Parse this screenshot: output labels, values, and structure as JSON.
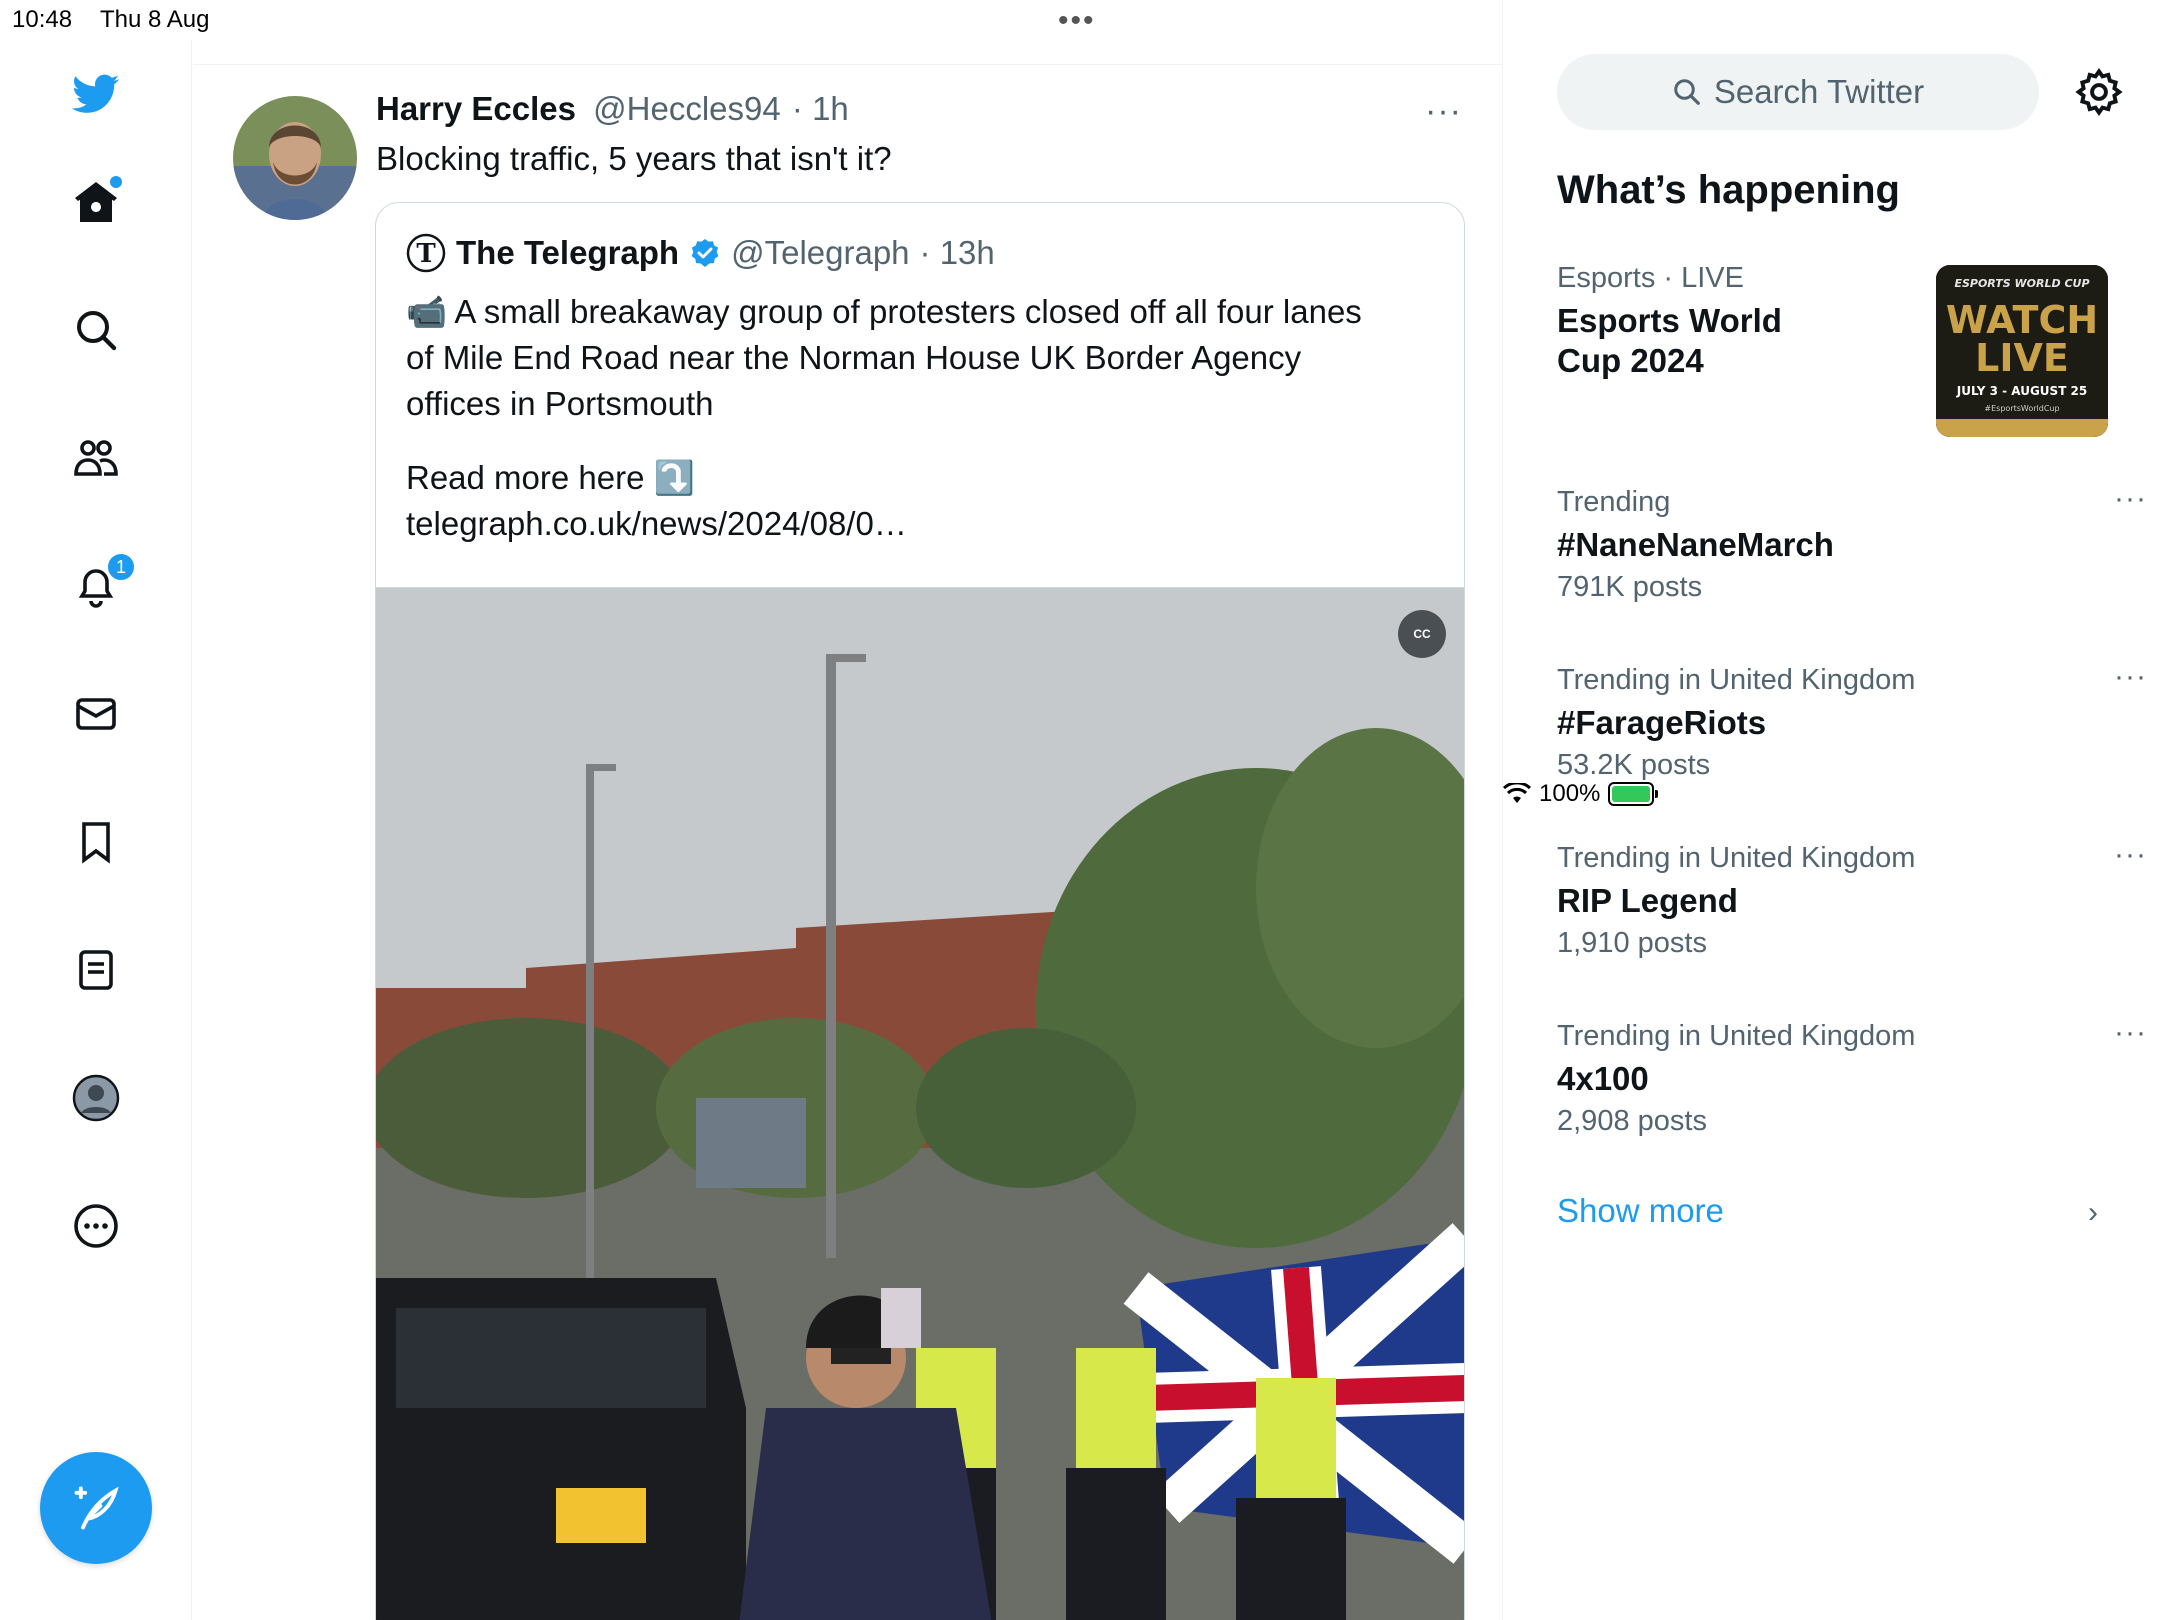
{
  "status_bar": {
    "time": "10:48",
    "date": "Thu 8 Aug",
    "battery_percent": "100%",
    "battery_level": 1.0
  },
  "nav": {
    "items": [
      {
        "name": "twitter-logo",
        "icon": "twitter-bird-icon"
      },
      {
        "name": "home",
        "icon": "home-icon",
        "has_dot": true
      },
      {
        "name": "explore",
        "icon": "search-icon"
      },
      {
        "name": "communities",
        "icon": "people-icon"
      },
      {
        "name": "notifications",
        "icon": "bell-icon",
        "badge": "1"
      },
      {
        "name": "messages",
        "icon": "mail-icon"
      },
      {
        "name": "bookmarks",
        "icon": "bookmark-icon"
      },
      {
        "name": "lists",
        "icon": "list-icon"
      },
      {
        "name": "profile",
        "icon": "profile-icon"
      },
      {
        "name": "more",
        "icon": "more-circle-icon"
      }
    ],
    "notifications_badge": "1",
    "compose_icon": "compose-feather-icon"
  },
  "tweet": {
    "author_name": "Harry Eccles",
    "author_handle": "@Heccles94",
    "time": "· 1h",
    "text": "Blocking traffic, 5 years that isn't it?",
    "more": "···",
    "quote": {
      "name": "The Telegraph",
      "handle": "@Telegraph",
      "time": "· 13h",
      "verified": true,
      "text_line1": "📹 A small breakaway group of protesters closed off all four lanes",
      "text_line2": "of Mile End Road near the Norman House UK Border Agency",
      "text_line3": "offices in Portsmouth",
      "read_more": "Read more here ⤵️",
      "link": "telegraph.co.uk/news/2024/08/0…",
      "captions_label": "CC"
    }
  },
  "sidebar": {
    "search_placeholder": "Search Twitter",
    "title": "What’s happening",
    "event": {
      "category": "Esports",
      "status": "· LIVE",
      "title_line1": "Esports World",
      "title_line2": "Cup 2024",
      "thumb_top": "ESPORTS WORLD CUP",
      "thumb_main1": "WATCH",
      "thumb_main2": "LIVE",
      "thumb_dates": "JULY 3 - AUGUST 25",
      "thumb_tag": "#EsportsWorldCup"
    },
    "trends": [
      {
        "meta": "Trending",
        "title": "#NaneNaneMarch",
        "count": "791K posts"
      },
      {
        "meta": "Trending in United Kingdom",
        "title": "#FarageRiots",
        "count": "53.2K posts"
      },
      {
        "meta": "Trending in United Kingdom",
        "title": "RIP Legend",
        "count": "1,910 posts"
      },
      {
        "meta": "Trending in United Kingdom",
        "title": "4x100",
        "count": "2,908 posts"
      }
    ],
    "more": "···",
    "show_more": "Show more",
    "show_more_chevron": "›"
  },
  "colors": {
    "accent": "#1d9bf0",
    "text_primary": "#0f1419",
    "text_secondary": "#536471",
    "border": "#cfd9de"
  }
}
